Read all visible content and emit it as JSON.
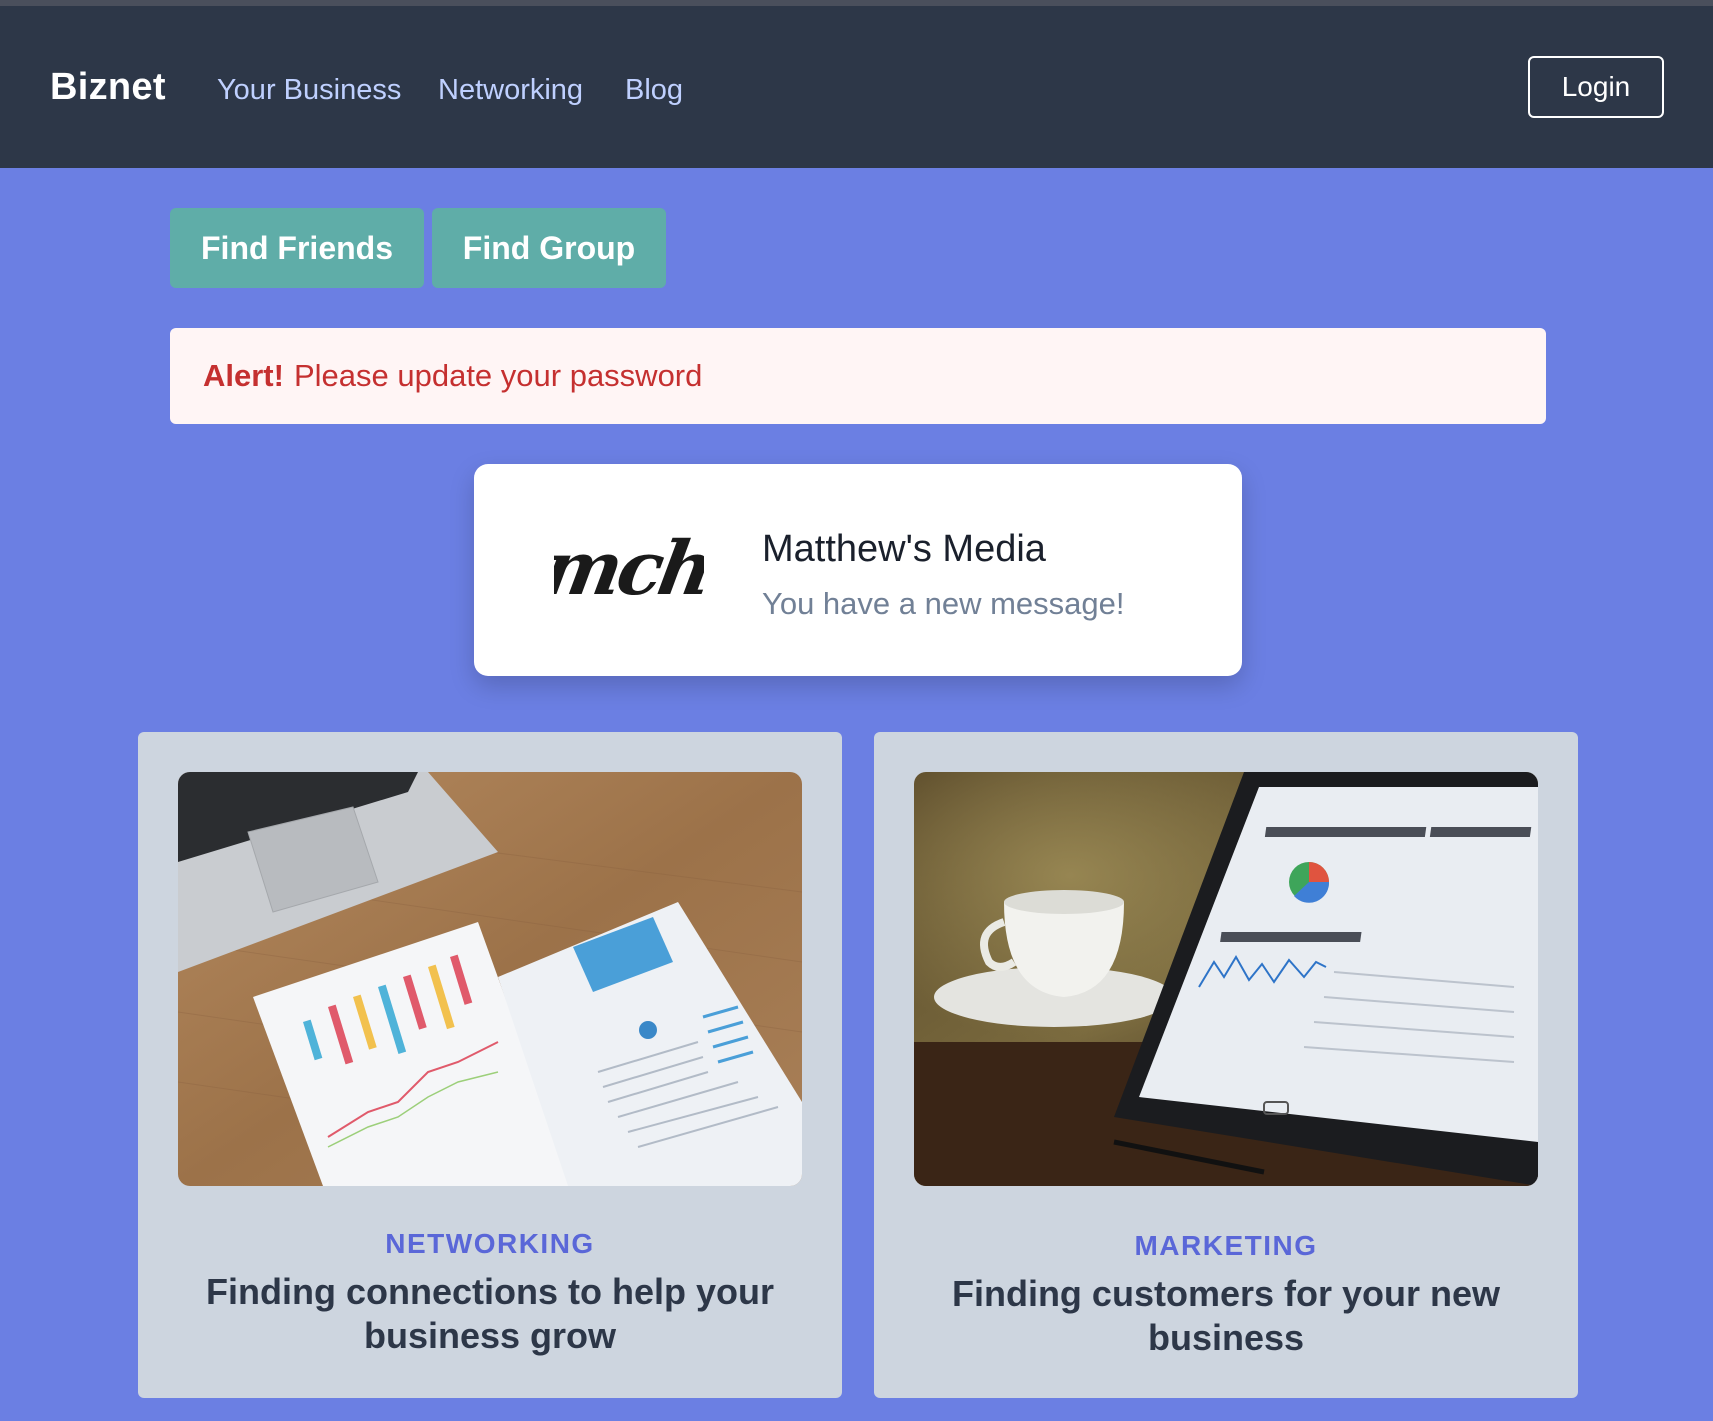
{
  "navbar": {
    "brand": "Biznet",
    "links": [
      "Your Business",
      "Networking",
      "Blog"
    ],
    "login_label": "Login"
  },
  "actions": {
    "find_friends": "Find Friends",
    "find_group": "Find Group"
  },
  "alert": {
    "strong": "Alert!",
    "message": "Please update your password"
  },
  "message_card": {
    "logo_text": "mch",
    "title": "Matthew's Media",
    "subtitle": "You have a new message!"
  },
  "cards": [
    {
      "category": "NETWORKING",
      "headline": "Finding connections to help your business grow",
      "image": "laptop-and-reports-photo"
    },
    {
      "category": "MARKETING",
      "headline": "Finding customers for your new business",
      "image": "tablet-analytics-photo"
    }
  ],
  "colors": {
    "navbar": "#2d3748",
    "page_bg": "#6b7fe3",
    "teal_button": "#5fada8",
    "alert_bg": "#fff5f5",
    "alert_text": "#c53030",
    "card_bg": "#cdd5df",
    "category": "#5a67d8"
  }
}
